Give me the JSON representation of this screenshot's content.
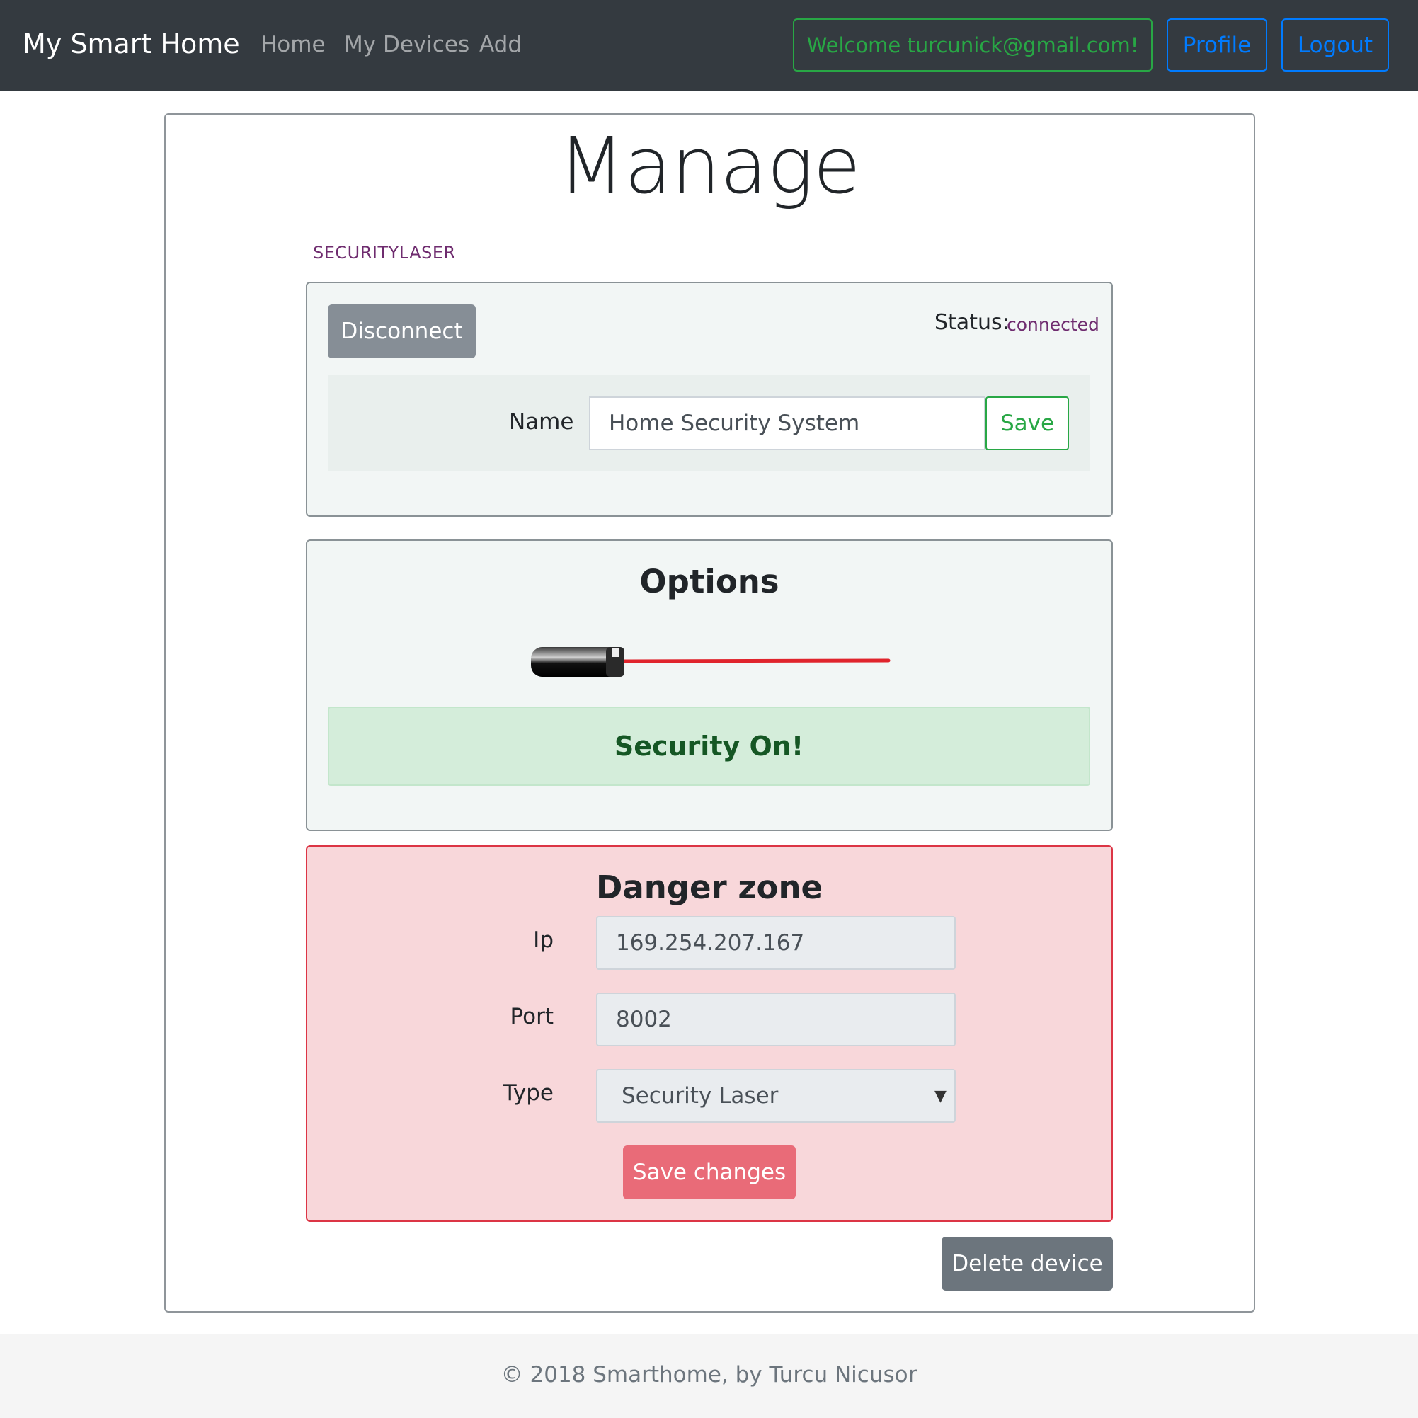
{
  "navbar": {
    "brand": "My Smart Home",
    "links": [
      "Home",
      "My Devices",
      "Add"
    ],
    "welcome": "Welcome turcunick@gmail.com!",
    "profile": "Profile",
    "logout": "Logout"
  },
  "page": {
    "title": "Manage",
    "device_type": "SECURITYLASER"
  },
  "connection": {
    "disconnect_label": "Disconnect",
    "status_label": "Status:",
    "status_value": "connected",
    "name_label": "Name",
    "name_value": "Home Security System",
    "save_label": "Save"
  },
  "options": {
    "title": "Options",
    "alert": "Security On!",
    "laser_icon": "laser-pointer-icon"
  },
  "danger": {
    "title": "Danger zone",
    "ip_label": "Ip",
    "ip_value": "169.254.207.167",
    "port_label": "Port",
    "port_value": "8002",
    "type_label": "Type",
    "type_value": "Security Laser",
    "save_changes": "Save changes"
  },
  "delete_label": "Delete device",
  "footer": "© 2018 Smarthome, by Turcu Nicusor",
  "colors": {
    "navbar": "#343a40",
    "success": "#28a745",
    "primary": "#007bff",
    "danger": "#dc3545",
    "danger_bg": "#f8d7da",
    "secondary": "#6c757d"
  }
}
